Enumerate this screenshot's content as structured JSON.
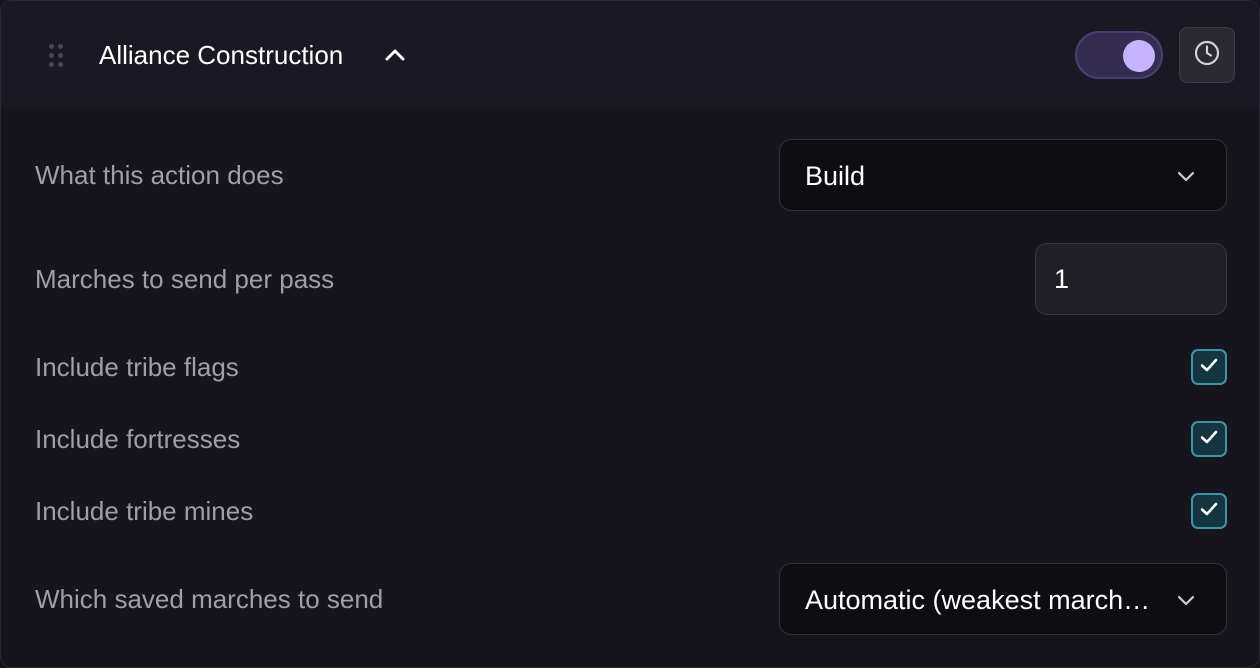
{
  "header": {
    "title": "Alliance Construction",
    "enabled": true
  },
  "settings": {
    "action": {
      "label": "What this action does",
      "value": "Build"
    },
    "marches_per_pass": {
      "label": "Marches to send per pass",
      "value": "1"
    },
    "include_tribe_flags": {
      "label": "Include tribe flags",
      "checked": true
    },
    "include_fortresses": {
      "label": "Include fortresses",
      "checked": true
    },
    "include_tribe_mines": {
      "label": "Include tribe mines",
      "checked": true
    },
    "saved_marches": {
      "label": "Which saved marches to send",
      "value": "Automatic (weakest marches first)"
    }
  },
  "icons": {
    "drag": "drag-handle-icon",
    "collapse": "chevron-up-icon",
    "history": "clock-icon",
    "dropdown": "chevron-down-icon",
    "check": "check-icon"
  },
  "colors": {
    "background": "#16141d",
    "header_background": "#1a1822",
    "toggle_track": "#352c52",
    "toggle_knob": "#c5b3ff",
    "checkbox_fill": "#143540",
    "checkbox_border": "#3e93a5",
    "checkmark": "#ffffff",
    "label_text": "#a19ea9"
  }
}
